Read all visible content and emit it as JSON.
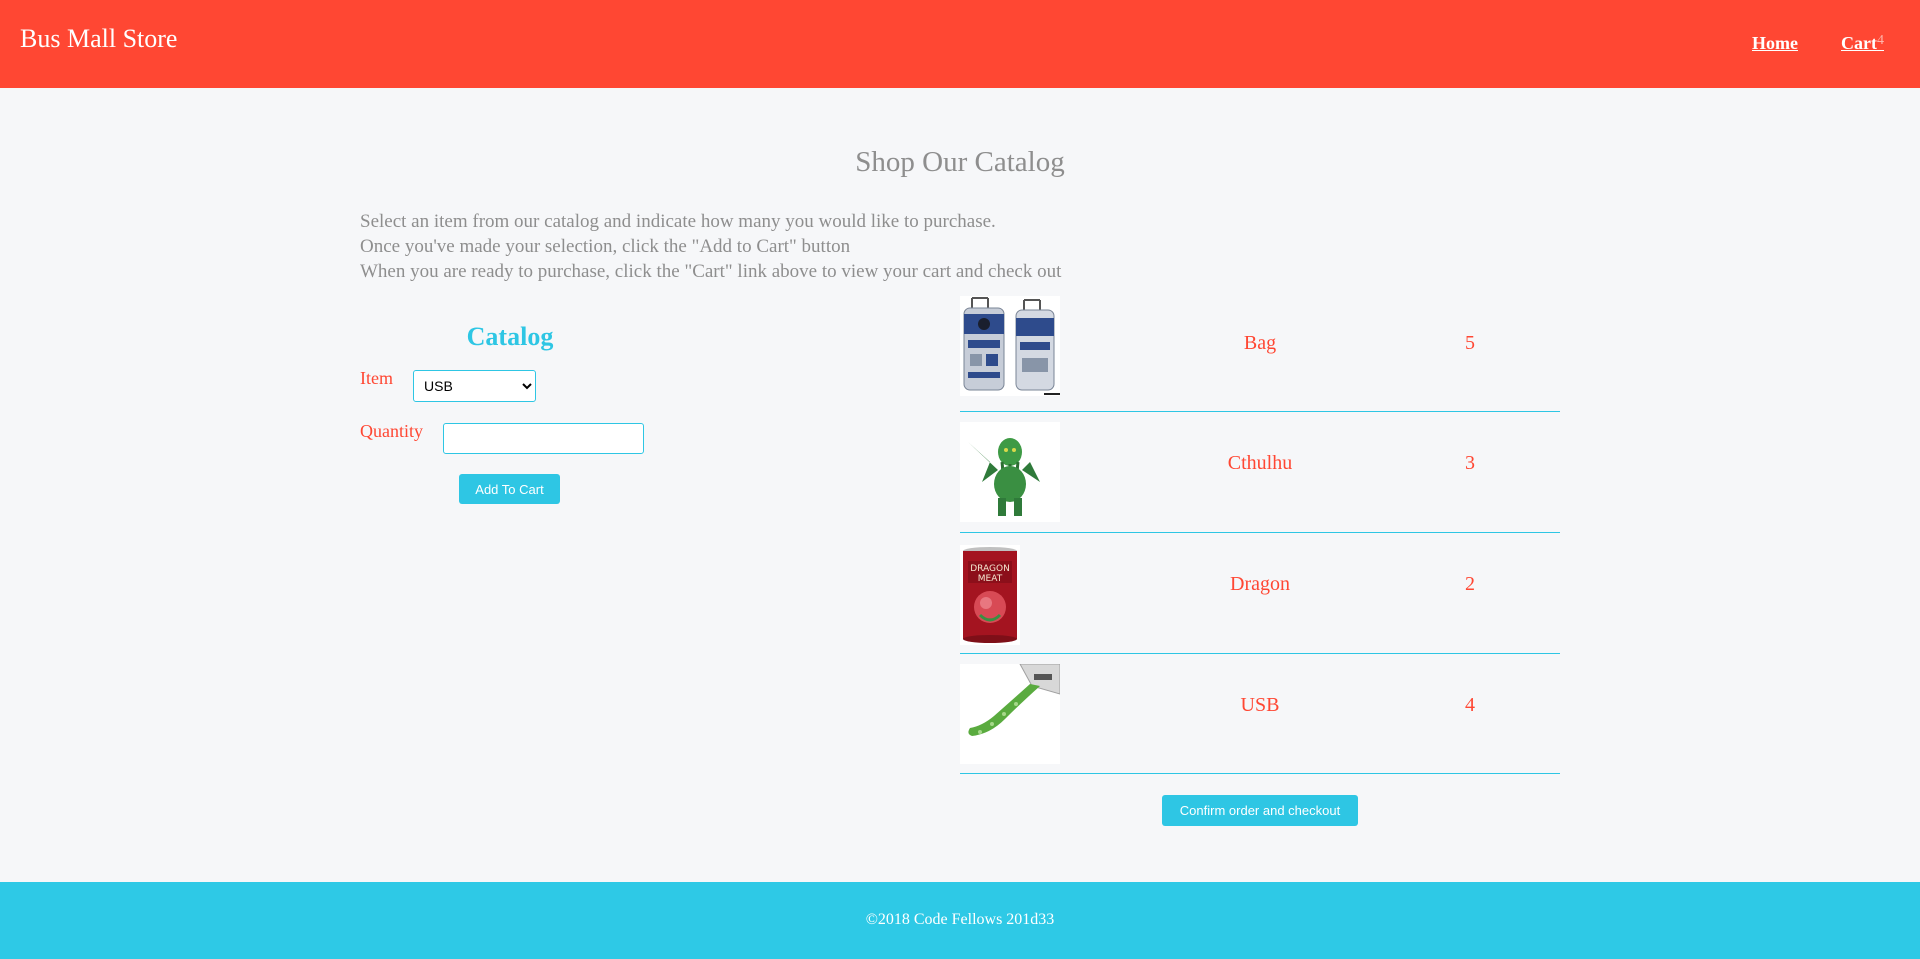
{
  "header": {
    "brand": "Bus Mall Store",
    "nav": {
      "home_label": "Home",
      "cart_label": "Cart",
      "cart_count": "4"
    },
    "background_color": "#ff4733"
  },
  "main": {
    "title": "Shop Our Catalog",
    "instructions": [
      "Select an item from our catalog and indicate how many you would like to purchase.",
      "Once you've made your selection, click the \"Add to Cart\" button",
      "When you are ready to purchase, click the \"Cart\" link above to view your cart and check out"
    ],
    "catalog": {
      "title": "Catalog",
      "item_label": "Item",
      "item_selected": "USB",
      "quantity_label": "Quantity",
      "quantity_value": "",
      "add_button_label": "Add To Cart"
    },
    "cart": {
      "rows": [
        {
          "name": "Bag",
          "quantity": "5",
          "icon": "r2d2-luggage-image"
        },
        {
          "name": "Cthulhu",
          "quantity": "3",
          "icon": "cthulhu-figure-image"
        },
        {
          "name": "Dragon",
          "quantity": "2",
          "icon": "dragon-meat-can-image"
        },
        {
          "name": "USB",
          "quantity": "4",
          "icon": "tentacle-usb-image"
        }
      ],
      "checkout_button_label": "Confirm order and checkout"
    },
    "accent_color": "#2ec6e4",
    "highlight_color": "#ff4733"
  },
  "footer": {
    "text": "©2018 Code Fellows 201d33",
    "background_color": "#2ec9e6"
  }
}
